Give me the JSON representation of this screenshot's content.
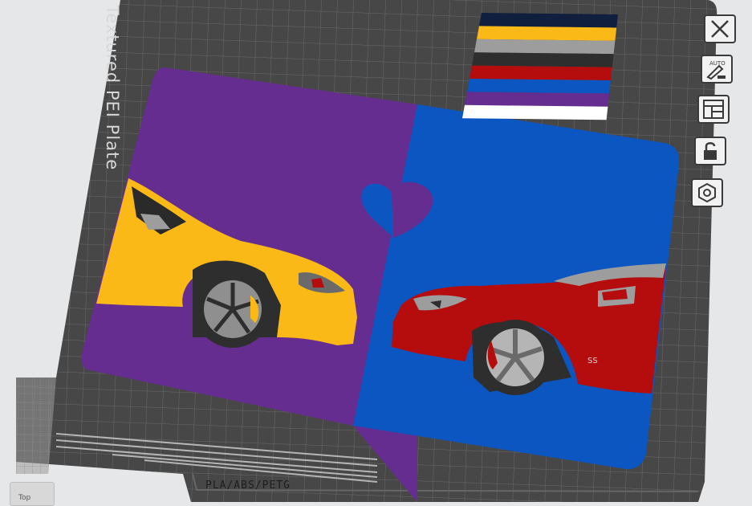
{
  "plate": {
    "label": "Textured PEI Plate",
    "filament_text": "PLA/ABS/PETG",
    "grid_color": "#5a5a5a",
    "plate_color": "#4a4a4a"
  },
  "model": {
    "left_color": "#662d91",
    "right_color": "#0b56c0",
    "heart_color": "#0b56c0",
    "left_car_color": "#fbb917",
    "right_car_color": "#b50d0d",
    "badge_text": "SS"
  },
  "swatch": {
    "colors": [
      "#0f1f3d",
      "#fbb917",
      "#9d9d9d",
      "#2e2e2e",
      "#b50d0d",
      "#0b56c0",
      "#662d91",
      "#ffffff"
    ]
  },
  "toolbar": {
    "buttons": [
      {
        "name": "close-view-button",
        "icon": "close-icon"
      },
      {
        "name": "auto-orient-button",
        "icon": "auto-orient-icon",
        "label": "AUTO"
      },
      {
        "name": "arrange-button",
        "icon": "layout-icon"
      },
      {
        "name": "lock-button",
        "icon": "unlock-icon"
      },
      {
        "name": "plate-settings-button",
        "icon": "nut-icon"
      }
    ]
  },
  "view": {
    "label": "Top"
  }
}
